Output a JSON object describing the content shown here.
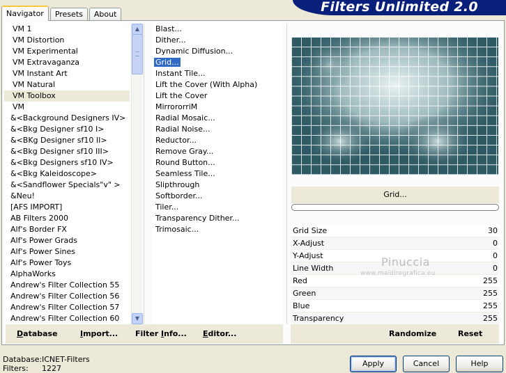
{
  "tabs": [
    {
      "label": "Navigator",
      "active": true
    },
    {
      "label": "Presets",
      "active": false
    },
    {
      "label": "About",
      "active": false
    }
  ],
  "banner_title": "Filters Unlimited 2.0",
  "categories": [
    "VM 1",
    "VM Distortion",
    "VM Experimental",
    "VM Extravaganza",
    "VM Instant Art",
    "VM Natural",
    "VM Toolbox",
    "VM",
    "&<Background Designers IV>",
    "&<Bkg Designer sf10 I>",
    "&<BKg Designer sf10 II>",
    "&<Bkg Designer sf10 III>",
    "&<Bkg Designers sf10 IV>",
    "&<Bkg Kaleidoscope>",
    "&<Sandflower Specials\"v\" >",
    "&Neu!",
    "[AFS IMPORT]",
    "AB Filters 2000",
    "Alf's Border FX",
    "Alf's Power Grads",
    "Alf's Power Sines",
    "Alf's Power Toys",
    "AlphaWorks",
    "Andrew's Filter Collection 55",
    "Andrew's Filter Collection 56",
    "Andrew's Filter Collection 57",
    "Andrew's Filter Collection 60"
  ],
  "highlighted_category": "VM Toolbox",
  "filters": [
    "Blast...",
    "Dither...",
    "Dynamic Diffusion...",
    "Grid...",
    "Instant Tile...",
    "Lift the Cover (With Alpha)",
    "Lift the Cover",
    "MirrororriM",
    "Radial Mosaic...",
    "Radial Noise...",
    "Reductor...",
    "Remove Gray...",
    "Round Button...",
    "Seamless Tile...",
    "Slipthrough",
    "Softborder...",
    "Tiler...",
    "Transparency Dither...",
    "Trimosaic..."
  ],
  "selected_filter": "Grid...",
  "filter_name": "Grid...",
  "params": [
    {
      "label": "Grid Size",
      "value": "30"
    },
    {
      "label": "X-Adjust",
      "value": "0"
    },
    {
      "label": "Y-Adjust",
      "value": "0"
    },
    {
      "label": "Line Width",
      "value": "0"
    },
    {
      "label": "Red",
      "value": "255"
    },
    {
      "label": "Green",
      "value": "255"
    },
    {
      "label": "Blue",
      "value": "255"
    },
    {
      "label": "Transparency",
      "value": "255"
    }
  ],
  "watermark": {
    "name": "Pinuccia",
    "url": "www.maidiregrafica.eu"
  },
  "left_buttons": {
    "database": {
      "u": "D",
      "rest": "atabase"
    },
    "import": {
      "u": "I",
      "rest": "mport..."
    },
    "filter_info": {
      "pre": "Filter ",
      "u": "I",
      "rest": "nfo..."
    },
    "editor": {
      "u": "E",
      "rest": "ditor..."
    }
  },
  "right_buttons": {
    "randomize": "Randomize",
    "reset": "Reset"
  },
  "status": {
    "database_label": "Database:",
    "database_value": "ICNET-Filters",
    "filters_label": "Filters:",
    "filters_value": "1227"
  },
  "dialog_buttons": {
    "apply": "Apply",
    "cancel": "Cancel",
    "help": "Help"
  },
  "colors": {
    "banner": "#0a1f7a",
    "selection": "#316ac5",
    "preview_base": "#2e5a64"
  }
}
